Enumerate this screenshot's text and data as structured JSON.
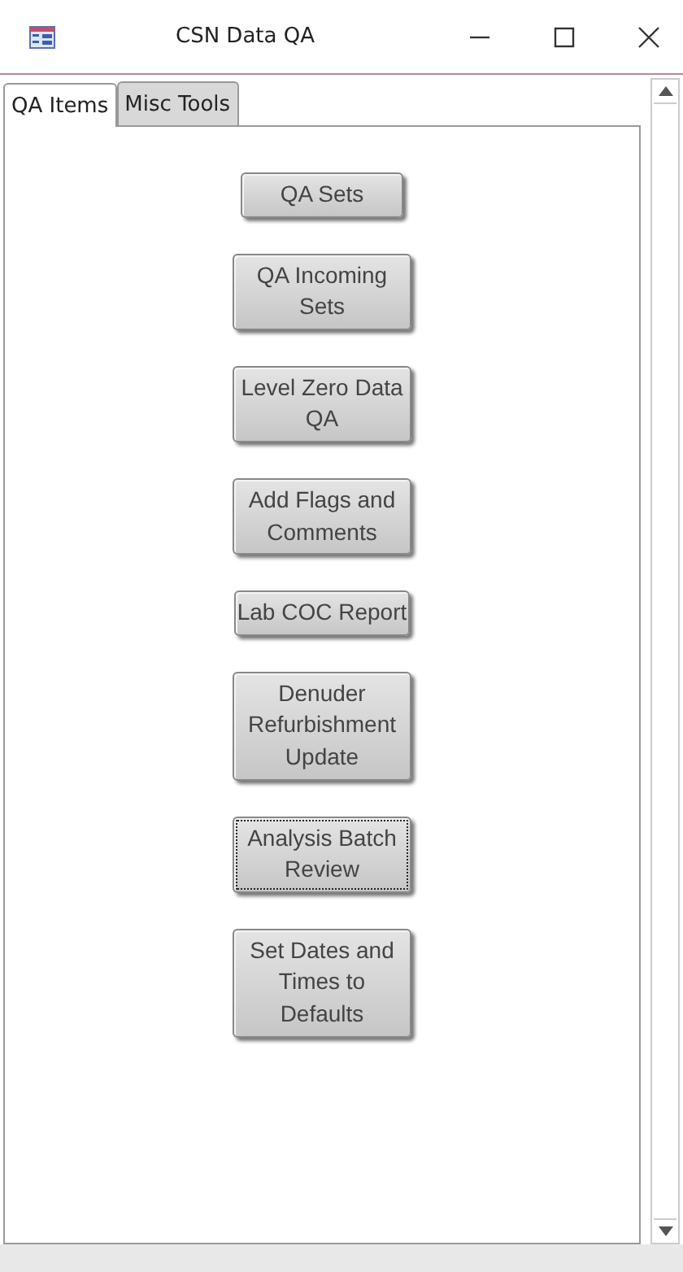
{
  "window": {
    "title": "CSN Data QA"
  },
  "tabs": [
    {
      "label": "QA Items",
      "selected": true
    },
    {
      "label": "Misc Tools",
      "selected": false
    }
  ],
  "buttons": [
    {
      "label": "QA Sets",
      "focused": false
    },
    {
      "label": "QA Incoming Sets",
      "focused": false
    },
    {
      "label": "Level Zero Data QA",
      "focused": false
    },
    {
      "label": "Add Flags and Comments",
      "focused": false
    },
    {
      "label": "Lab COC Report",
      "focused": false
    },
    {
      "label": "Denuder Refurbishment Update",
      "focused": false
    },
    {
      "label": "Analysis Batch Review",
      "focused": true
    },
    {
      "label": "Set Dates and Times to Defaults",
      "focused": false
    }
  ]
}
